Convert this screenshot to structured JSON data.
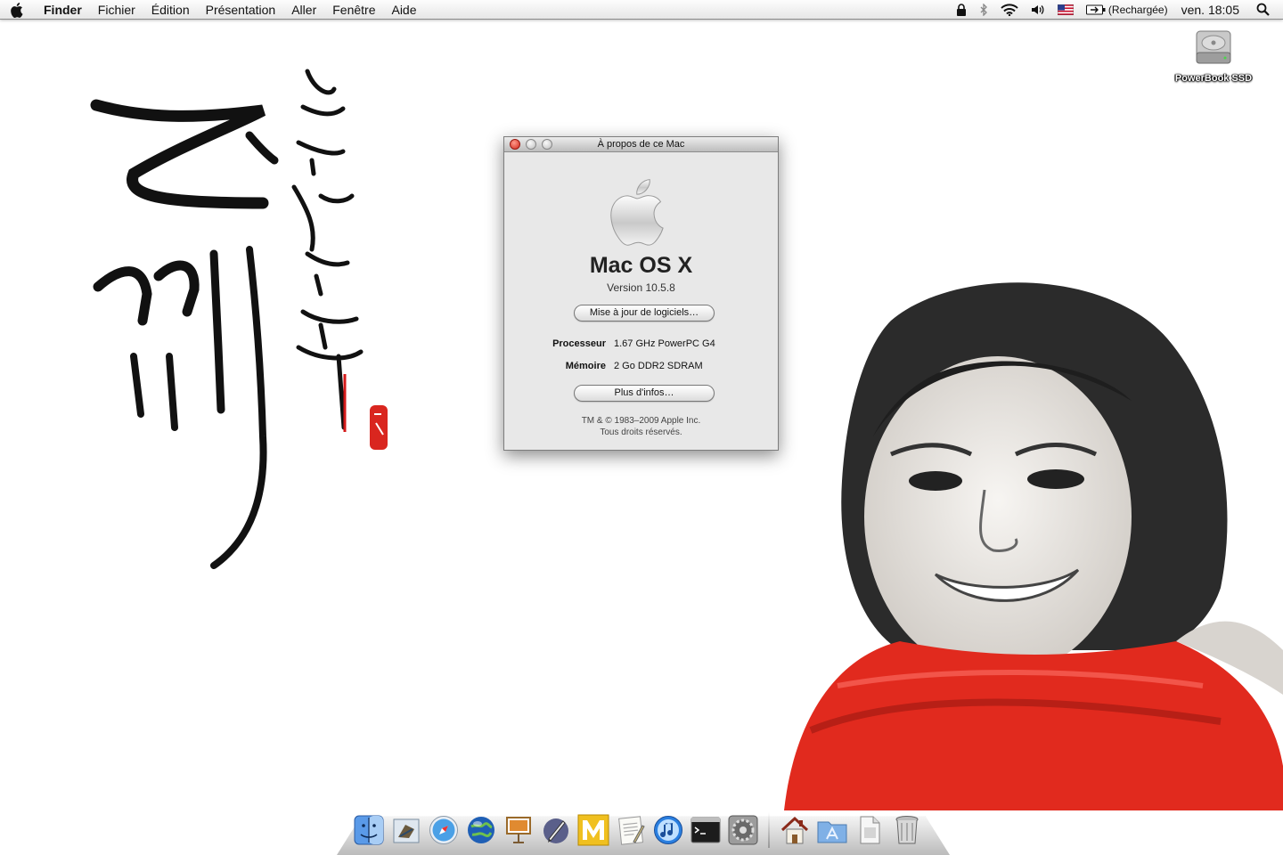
{
  "menubar": {
    "app_name": "Finder",
    "menus": [
      "Fichier",
      "Édition",
      "Présentation",
      "Aller",
      "Fenêtre",
      "Aide"
    ],
    "icons": [
      "apple-icon",
      "lock-icon",
      "bluetooth-icon",
      "wifi-icon",
      "volume-icon",
      "us-flag-icon",
      "battery-icon",
      "spotlight-icon"
    ],
    "battery_status": "(Rechargée)",
    "clock": "ven. 18:05"
  },
  "desktop": {
    "volume_label": "PowerBook SSD",
    "volume_icon": "hard-drive-icon"
  },
  "about_window": {
    "title": "À propos de ce Mac",
    "os_name": "Mac OS X",
    "version": "Version 10.5.8",
    "update_button": "Mise à jour de logiciels…",
    "processor_label": "Processeur",
    "processor_value": "1.67 GHz PowerPC G4",
    "memory_label": "Mémoire",
    "memory_value": "2 Go  DDR2 SDRAM",
    "more_button": "Plus d'infos…",
    "legal_line1": "TM & © 1983–2009 Apple Inc.",
    "legal_line2": "Tous droits réservés."
  },
  "dock": {
    "apps": [
      {
        "name": "Finder",
        "icon": "finder-icon",
        "color": "#3b7fe0"
      },
      {
        "name": "Mail",
        "icon": "mail-icon",
        "color": "#8a6a3a"
      },
      {
        "name": "Safari",
        "icon": "safari-icon",
        "color": "#3a8fd8"
      },
      {
        "name": "Camino",
        "icon": "globe-icon",
        "color": "#1f5fb5"
      },
      {
        "name": "Keynote",
        "icon": "keynote-icon",
        "color": "#c8782a"
      },
      {
        "name": "Pen tool",
        "icon": "pen-icon",
        "color": "#5a5f8a"
      },
      {
        "name": "M",
        "icon": "m-app-icon",
        "color": "#e7b400"
      },
      {
        "name": "TextEdit",
        "icon": "textedit-icon",
        "color": "#d8d8d0"
      },
      {
        "name": "iTunes",
        "icon": "itunes-icon",
        "color": "#2a7fe0"
      },
      {
        "name": "Terminal",
        "icon": "terminal-icon",
        "color": "#222222"
      },
      {
        "name": "System Preferences",
        "icon": "gear-icon",
        "color": "#8c8c8c"
      }
    ],
    "folders": [
      {
        "name": "Home",
        "icon": "home-icon"
      },
      {
        "name": "Applications",
        "icon": "applications-folder-icon"
      },
      {
        "name": "Document",
        "icon": "document-icon"
      },
      {
        "name": "Trash",
        "icon": "trash-icon"
      }
    ]
  }
}
